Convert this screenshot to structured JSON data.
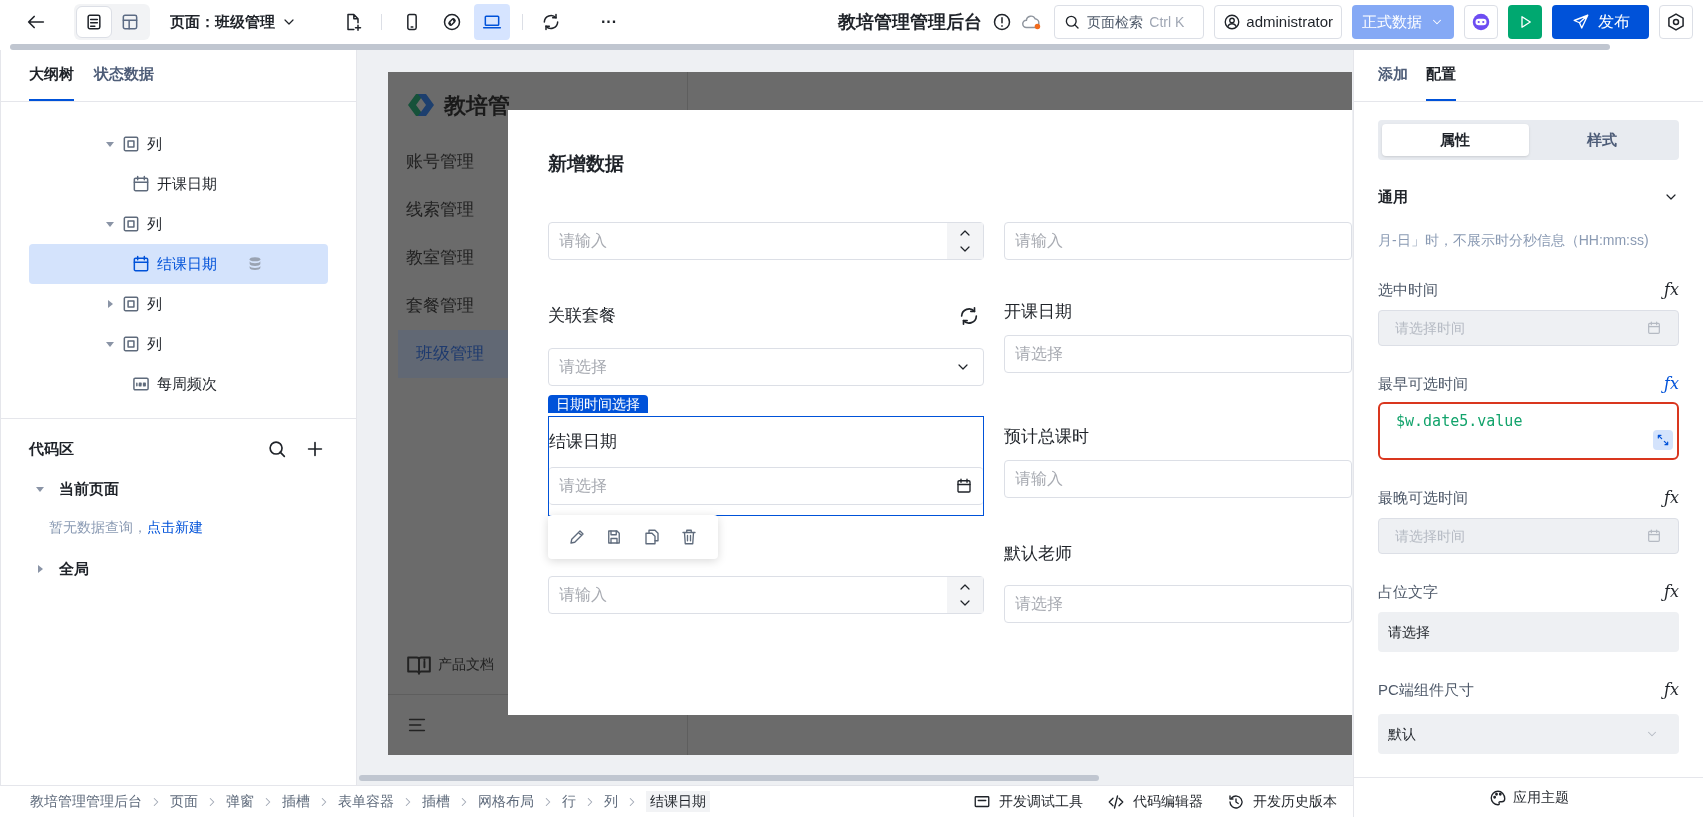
{
  "toolbar": {
    "view_modes": [
      {
        "kind": "outline",
        "selected": true
      },
      {
        "kind": "layout",
        "selected": false
      }
    ],
    "page_label": "页面：班级管理",
    "devices": [
      {
        "kind": "mobile",
        "selected": false
      },
      {
        "kind": "link",
        "selected": false
      },
      {
        "kind": "desktop",
        "selected": true
      }
    ],
    "more": "···",
    "app_title": "教培管理管理后台",
    "search": {
      "placeholder": "页面检索",
      "shortcut": "Ctrl K"
    },
    "user": "administrator",
    "env": "正式数据",
    "publish": "发布"
  },
  "left_panel": {
    "tabs": [
      {
        "label": "大纲树",
        "selected": true
      },
      {
        "label": "状态数据",
        "selected": false
      }
    ],
    "tree": [
      {
        "label": "列",
        "kind": "column",
        "expanded": true,
        "selected": false,
        "children": [
          {
            "label": "开课日期",
            "kind": "date",
            "selected": false
          }
        ]
      },
      {
        "label": "列",
        "kind": "column",
        "expanded": true,
        "selected": false,
        "children": [
          {
            "label": "结课日期",
            "kind": "date",
            "selected": true,
            "bound": true
          }
        ]
      },
      {
        "label": "列",
        "kind": "column",
        "expanded": false,
        "selected": false
      },
      {
        "label": "列",
        "kind": "column",
        "expanded": true,
        "selected": false,
        "children": [
          {
            "label": "每周频次",
            "kind": "number",
            "selected": false
          }
        ]
      }
    ],
    "code_area": {
      "title": "代码区",
      "groups": [
        {
          "label": "当前页面",
          "expanded": true,
          "empty_text": "暂无数据查询，",
          "link": "点击新建"
        },
        {
          "label": "全局",
          "expanded": false
        }
      ]
    }
  },
  "canvas": {
    "app_logo": "教培管",
    "menu": [
      {
        "label": "账号管理",
        "selected": false
      },
      {
        "label": "线索管理",
        "selected": false
      },
      {
        "label": "教室管理",
        "selected": false
      },
      {
        "label": "套餐管理",
        "selected": false
      },
      {
        "label": "班级管理",
        "selected": true
      }
    ],
    "docs": "产品文档",
    "modal": {
      "title": "新增数据",
      "left_fields": [
        {
          "kind": "number",
          "placeholder": "请输入"
        },
        {
          "kind": "select",
          "label": "关联套餐",
          "placeholder": "请选择"
        },
        {
          "kind": "date",
          "label": "结课日期",
          "placeholder": "请选择",
          "selected": true,
          "badge": "日期时间选择"
        },
        {
          "kind": "number",
          "placeholder": "请输入"
        }
      ],
      "right_fields": [
        {
          "kind": "text",
          "placeholder": "请输入"
        },
        {
          "kind": "text",
          "label": "开课日期",
          "placeholder": "请选择"
        },
        {
          "kind": "text",
          "label": "预计总课时",
          "placeholder": "请输入"
        },
        {
          "kind": "text",
          "label": "默认老师",
          "placeholder": "请选择"
        }
      ]
    }
  },
  "right_panel": {
    "tabs": [
      {
        "label": "添加",
        "selected": false
      },
      {
        "label": "配置",
        "selected": true
      }
    ],
    "segments": [
      {
        "label": "属性",
        "selected": true
      },
      {
        "label": "样式",
        "selected": false
      }
    ],
    "section": {
      "title": "通用",
      "expanded": true
    },
    "note": "月-日」时，不展示时分秒信息（HH:mm:ss)",
    "props": [
      {
        "label": "选中时间",
        "fx": "ƒx",
        "kind": "date",
        "placeholder": "请选择时间",
        "bound": false
      },
      {
        "label": "最早可选时间",
        "fx": "ƒx",
        "kind": "code",
        "value": "$w.date5.value",
        "bound": true
      },
      {
        "label": "最晚可选时间",
        "fx": "ƒx",
        "kind": "date",
        "placeholder": "请选择时间",
        "bound": false
      },
      {
        "label": "占位文字",
        "fx": "ƒx",
        "kind": "text",
        "value": "请选择",
        "bound": false
      },
      {
        "label": "PC端组件尺寸",
        "fx": "ƒx",
        "kind": "select",
        "value": "默认",
        "bound": false
      }
    ],
    "footer": "应用主题"
  },
  "status_bar": {
    "breadcrumb": [
      "教培管理管理后台",
      "页面",
      "弹窗",
      "插槽",
      "表单容器",
      "插槽",
      "网格布局",
      "行",
      "列",
      "结课日期"
    ],
    "tools": [
      {
        "kind": "debug",
        "label": "开发调试工具"
      },
      {
        "kind": "code",
        "label": "代码编辑器"
      },
      {
        "kind": "history",
        "label": "开发历史版本"
      }
    ]
  }
}
